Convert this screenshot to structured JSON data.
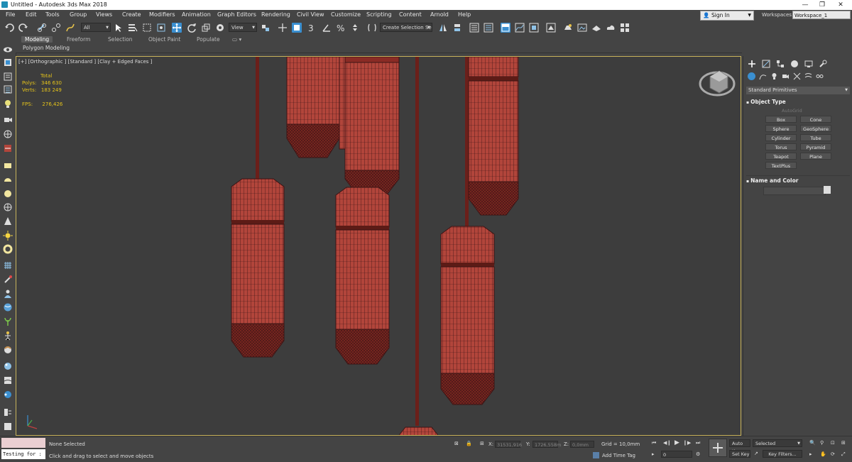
{
  "window": {
    "title": "Untitled - Autodesk 3ds Max 2018",
    "minimize": "—",
    "restore": "❐",
    "close": "✕"
  },
  "menu": [
    "File",
    "Edit",
    "Tools",
    "Group",
    "Views",
    "Create",
    "Modifiers",
    "Animation",
    "Graph Editors",
    "Rendering",
    "Civil View",
    "Customize",
    "Scripting",
    "Content",
    "Arnold",
    "Help"
  ],
  "account": {
    "sign_in": "Sign In",
    "workspaces_label": "Workspaces:",
    "workspace_value": "Workspace_1"
  },
  "toolbar": {
    "selection_filter": "All",
    "reference_coord": "View",
    "selection_set": "Create Selection Se",
    "snap_label": "3"
  },
  "ribbon": {
    "tabs": [
      "Modeling",
      "Freeform",
      "Selection",
      "Object Paint",
      "Populate"
    ],
    "active_tab": "Modeling",
    "sub_label": "Polygon Modeling"
  },
  "viewport": {
    "label": "[+] [Orthographic ] [Standard ] [Clay + Edged Faces ]",
    "stats": {
      "total_label": "Total",
      "polys_label": "Polys:",
      "polys_value": "346 630",
      "verts_label": "Verts:",
      "verts_value": "183 249",
      "fps_label": "FPS:",
      "fps_value": "276,426"
    }
  },
  "command_panel": {
    "dropdown": "Standard Primitives",
    "object_type_title": "Object Type",
    "autogrid": "AutoGrid",
    "buttons": [
      "Box",
      "Cone",
      "Sphere",
      "GeoSphere",
      "Cylinder",
      "Tube",
      "Torus",
      "Pyramid",
      "Teapot",
      "Plane",
      "TextPlus"
    ],
    "name_color_title": "Name and Color"
  },
  "status": {
    "maxscript_text": "Testing for :",
    "selection_status": "None Selected",
    "prompt": "Click and drag to select and move objects",
    "x_label": "X:",
    "x_value": "31531,916",
    "y_label": "Y:",
    "y_value": "1726,558m",
    "z_label": "Z:",
    "z_value": "0,0mm",
    "grid": "Grid = 10,0mm",
    "add_time_tag": "Add Time Tag",
    "auto_key": "Auto Key",
    "set_key": "Set Key",
    "selected": "Selected",
    "key_filters": "Key Filters...",
    "frame": "0"
  },
  "colors": {
    "accent_blue": "#3a8fd0",
    "viewport_border": "#c7b25a",
    "stats_yellow": "#e5c31a",
    "mesh_red": "#b2453b"
  }
}
